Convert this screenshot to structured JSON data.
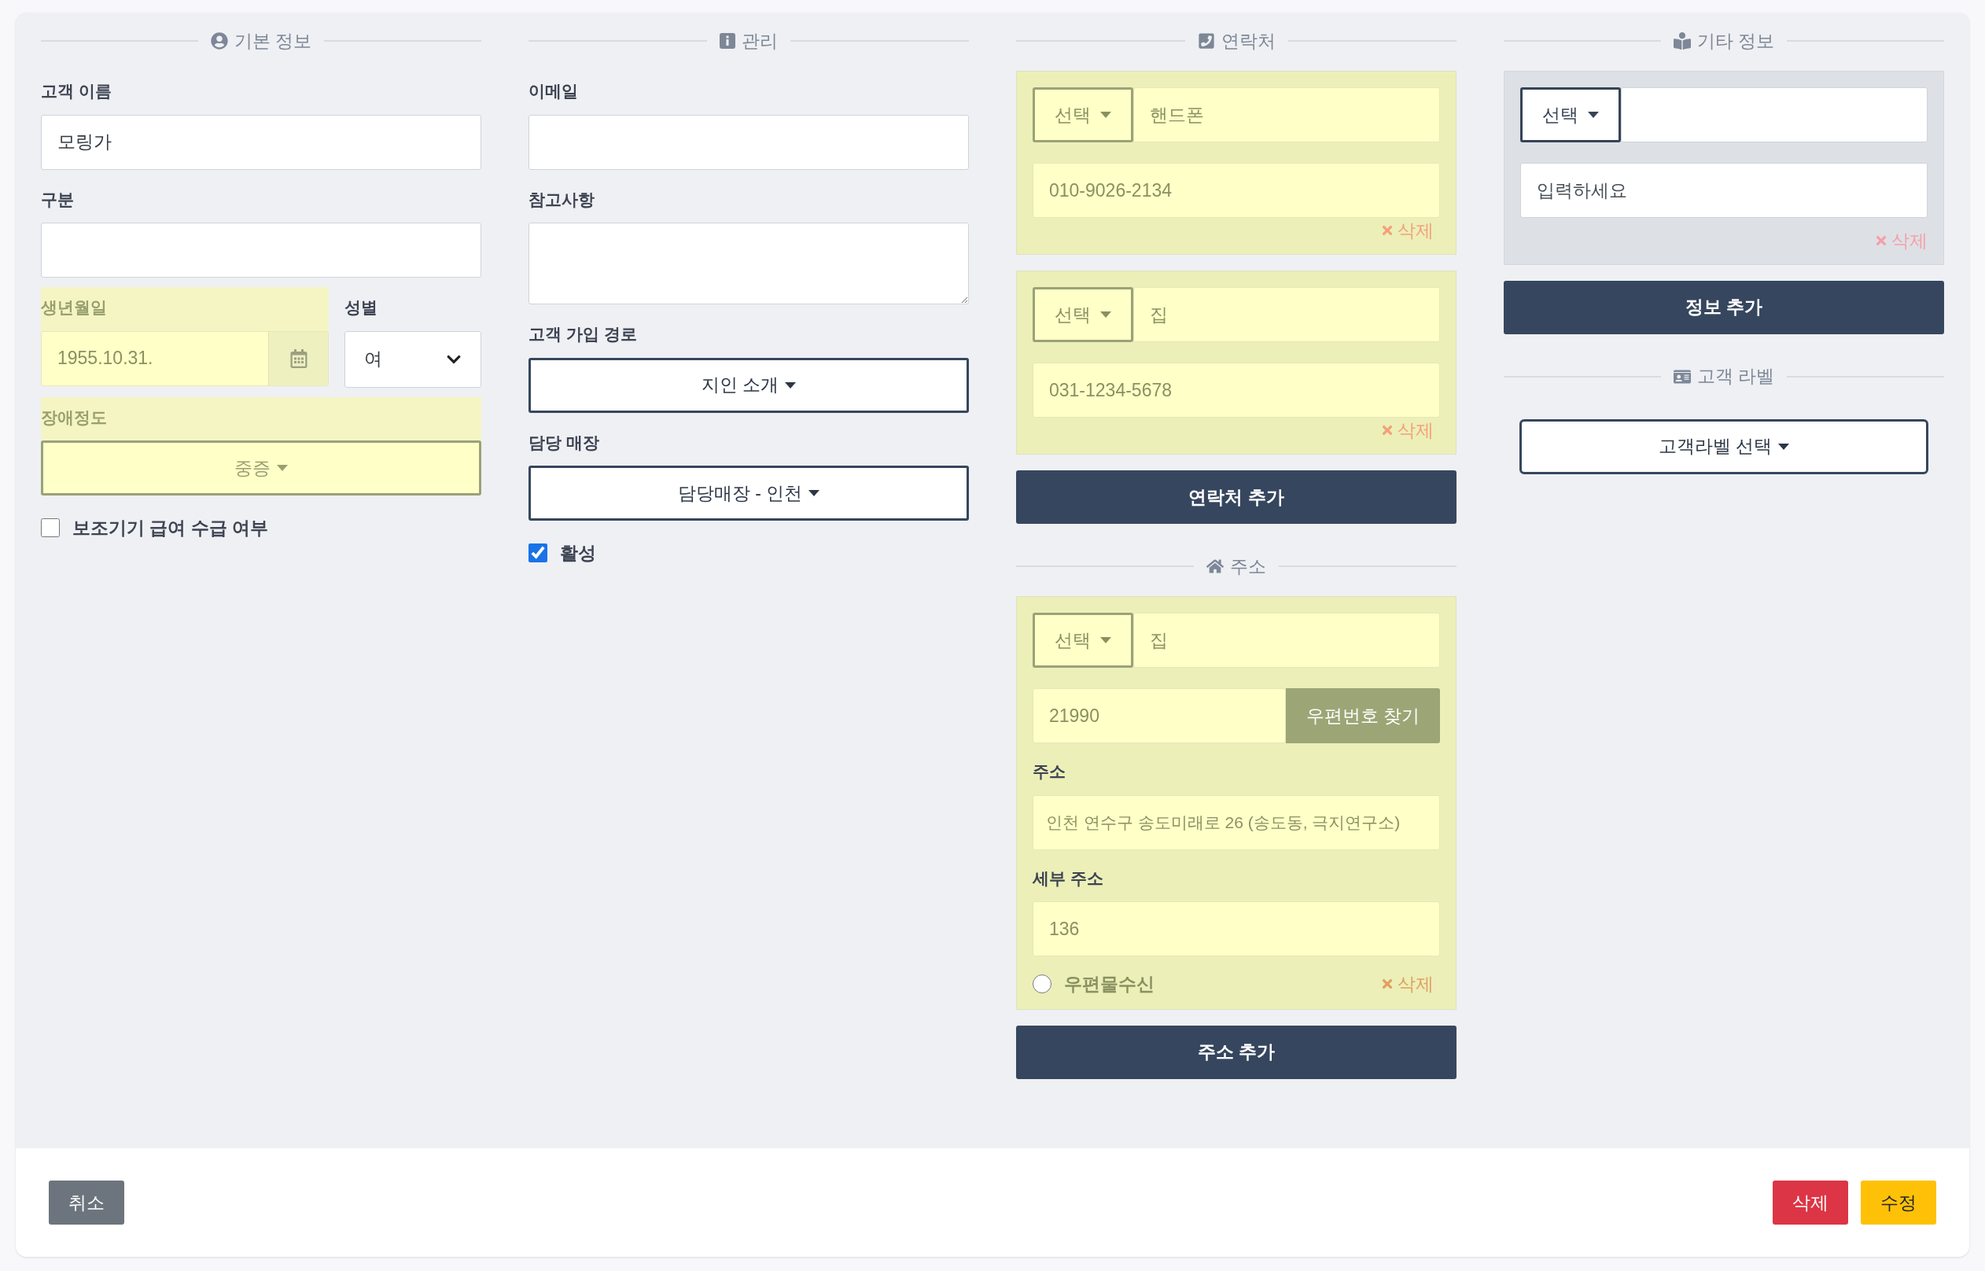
{
  "basic_info": {
    "title": "기본 정보",
    "name": {
      "label": "고객 이름",
      "value": "모링가"
    },
    "category": {
      "label": "구분"
    },
    "birth": {
      "label": "생년월일",
      "value": "1955.10.31.",
      "highlighted": true
    },
    "gender": {
      "label": "성별",
      "value": "여"
    },
    "disability": {
      "label": "장애정도",
      "value": "중증",
      "highlighted": true
    },
    "aid_benefit": {
      "label": "보조기기 급여 수급 여부",
      "checked": false
    }
  },
  "management": {
    "title": "관리",
    "email": {
      "label": "이메일"
    },
    "notes": {
      "label": "참고사항"
    },
    "signup_route": {
      "label": "고객 가입 경로",
      "value": "지인 소개"
    },
    "store": {
      "label": "담당 매장",
      "value": "담당매장 - 인천"
    },
    "active": {
      "label": "활성",
      "checked": true
    }
  },
  "contacts": {
    "title": "연락처",
    "items": [
      {
        "type_button": "선택",
        "type": "핸드폰",
        "number": "010-9026-2134",
        "delete": {
          "label": "삭제",
          "disabled": false
        },
        "highlighted": true
      },
      {
        "type_button": "선택",
        "type": "집",
        "number": "031-1234-5678",
        "delete": {
          "label": "삭제",
          "disabled": false
        },
        "highlighted": true
      }
    ],
    "add_button": "연락처 추가"
  },
  "address": {
    "title": "주소",
    "items": [
      {
        "type_button": "선택",
        "type": "집",
        "postcode": "21990",
        "find_button": "우편번호 찾기",
        "address_label": "주소",
        "address": "인천 연수구 송도미래로 26 (송도동, 극지연구소)",
        "detail_label": "세부 주소",
        "detail": "136",
        "mail": {
          "label": "우편물수신",
          "selected": false
        },
        "delete": {
          "label": "삭제",
          "disabled": true
        },
        "highlighted": true
      }
    ],
    "add_button": "주소 추가"
  },
  "other_info": {
    "title": "기타 정보",
    "items": [
      {
        "type_button": "선택",
        "placeholder": "입력하세요",
        "delete": {
          "label": "삭제",
          "disabled": false
        },
        "highlighted": false
      }
    ],
    "add_button": "정보 추가"
  },
  "customer_label": {
    "title": "고객 라벨",
    "button": "고객라벨 선택"
  },
  "footer": {
    "cancel": "취소",
    "delete": "삭제",
    "save": "수정"
  }
}
